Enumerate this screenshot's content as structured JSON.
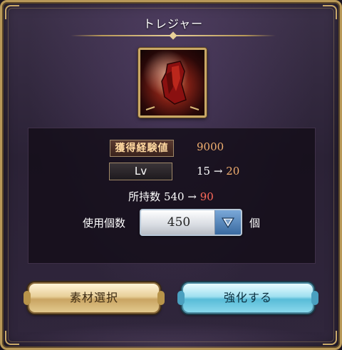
{
  "window": {
    "title": "トレジャー"
  },
  "item": {
    "icon": "red-treasure-icon"
  },
  "stats": {
    "exp_label": "獲得経験値",
    "exp_value": "9000",
    "lv_label": "Lv",
    "lv_from": "15",
    "lv_arrow": "→",
    "lv_to": "20",
    "owned_label": "所持数",
    "owned_from": "540",
    "owned_arrow": "→",
    "owned_to": "90"
  },
  "quantity": {
    "label": "使用個数",
    "value": "450",
    "unit": "個",
    "dropdown_icon": "dropdown-arrow-icon"
  },
  "buttons": {
    "select_material": "素材選択",
    "enhance": "強化する"
  },
  "colors": {
    "accent_orange": "#f3b070",
    "accent_red": "#ff6a5a",
    "frame_gold": "#b89858"
  }
}
